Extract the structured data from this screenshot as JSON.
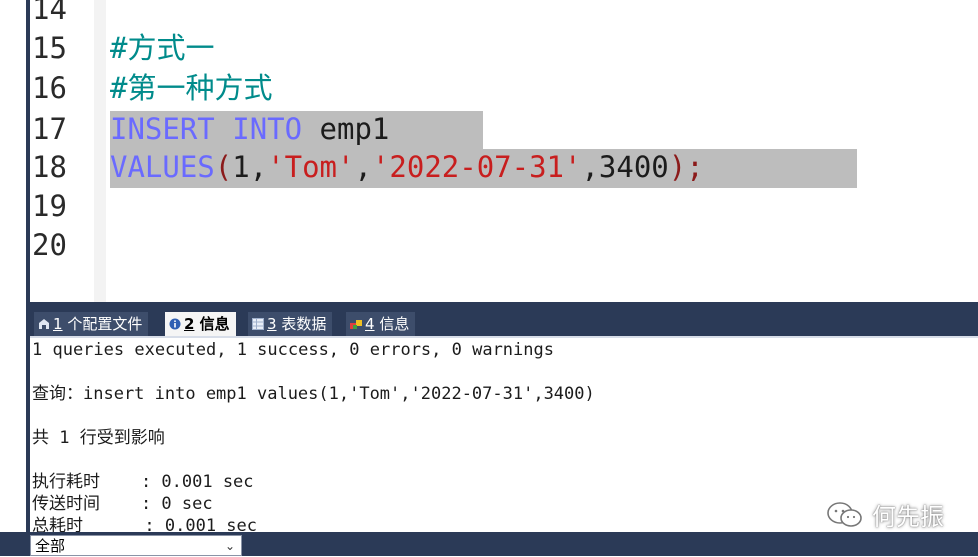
{
  "editor": {
    "lines": [
      {
        "num": "14",
        "segments": []
      },
      {
        "num": "15",
        "segments": [
          {
            "text": "#方式一",
            "cls": "comment"
          }
        ]
      },
      {
        "num": "16",
        "segments": [
          {
            "text": "#第一种方式",
            "cls": "comment"
          }
        ]
      },
      {
        "num": "17",
        "segments": [
          {
            "text": "INSERT",
            "cls": "kw"
          },
          {
            "text": " ",
            "cls": "plain"
          },
          {
            "text": "INTO",
            "cls": "kw"
          },
          {
            "text": " emp1 ",
            "cls": "plain"
          }
        ]
      },
      {
        "num": "18",
        "segments": [
          {
            "text": "VALUES",
            "cls": "kw"
          },
          {
            "text": "(",
            "cls": "paren"
          },
          {
            "text": "1,",
            "cls": "plain"
          },
          {
            "text": "'Tom'",
            "cls": "str"
          },
          {
            "text": ",",
            "cls": "plain"
          },
          {
            "text": "'2022-07-31'",
            "cls": "str"
          },
          {
            "text": ",3400",
            "cls": "plain"
          },
          {
            "text": ");",
            "cls": "paren"
          }
        ]
      },
      {
        "num": "19",
        "segments": []
      },
      {
        "num": "20",
        "segments": []
      }
    ]
  },
  "tabs": [
    {
      "num": "1",
      "label": " 个配置文件",
      "icon": "profile-icon",
      "active": false
    },
    {
      "num": "2",
      "label": " 信息",
      "icon": "info-icon",
      "active": true
    },
    {
      "num": "3",
      "label": " 表数据",
      "icon": "table-icon",
      "active": false
    },
    {
      "num": "4",
      "label": " 信息",
      "icon": "info-grid-icon",
      "active": false
    }
  ],
  "output": {
    "lines": [
      "1 queries executed, 1 success, 0 errors, 0 warnings",
      "",
      "查询：insert into emp1 values(1,'Tom','2022-07-31',3400)",
      "",
      "共 1 行受到影响",
      "",
      "执行耗时    : 0.001 sec",
      "传送时间    : 0 sec",
      "总耗时      : 0.001 sec"
    ]
  },
  "filter": {
    "value": "全部"
  },
  "watermark": {
    "text": "何先振"
  },
  "colors": {
    "panel": "#2b3a57",
    "selection": "#bdbdbd",
    "comment": "#008b8b",
    "keyword": "#6a6aff",
    "string": "#c81e1e"
  }
}
